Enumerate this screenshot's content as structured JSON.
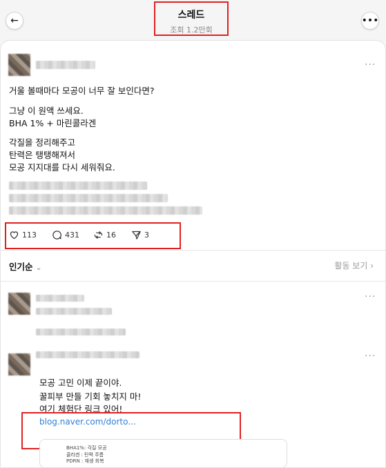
{
  "header": {
    "title": "스레드",
    "subtitle": "조회 1.2만회"
  },
  "post": {
    "lines": [
      "거울 볼때마다 모공이 너무 잘 보인다면?",
      "그냥 이 원액 쓰세요.",
      "BHA 1% + 마린콜라겐",
      "각질을 정리해주고",
      "탄력은 탱탱해져서",
      "모공 지지대를 다시 세워줘요."
    ],
    "likes": "113",
    "comments": "431",
    "reposts": "16",
    "shares": "3"
  },
  "sort": {
    "label": "인기순",
    "activity": "활동 보기 ›"
  },
  "reply": {
    "lines": [
      "모공 고민 이제 끝이야.",
      "꿀피부 만들 기회 놓치지 마!",
      "여기 체험단 링크 있어!"
    ],
    "link": "blog.naver.com/dorto...",
    "preview_lines": [
      "BHA1%: 각질 모공",
      "콜라겐 : 탄력 주름",
      "PDRN : 재생 회복"
    ]
  },
  "icons": [
    "back-arrow-icon",
    "more-icon",
    "heart-icon",
    "comment-icon",
    "repost-icon",
    "share-icon",
    "chevron-down-icon"
  ]
}
